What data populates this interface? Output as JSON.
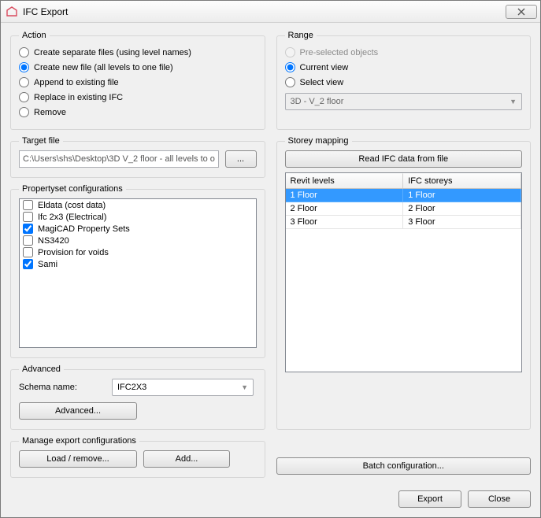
{
  "window": {
    "title": "IFC Export"
  },
  "action": {
    "legend": "Action",
    "options": [
      {
        "label": "Create separate files (using level names)",
        "checked": false
      },
      {
        "label": "Create new file (all levels to one file)",
        "checked": true
      },
      {
        "label": "Append to existing file",
        "checked": false
      },
      {
        "label": "Replace in existing IFC",
        "checked": false
      },
      {
        "label": "Remove",
        "checked": false
      }
    ]
  },
  "range": {
    "legend": "Range",
    "options": [
      {
        "label": "Pre-selected objects",
        "checked": false,
        "enabled": false
      },
      {
        "label": "Current view",
        "checked": true,
        "enabled": true
      },
      {
        "label": "Select view",
        "checked": false,
        "enabled": true
      }
    ],
    "view_select": "3D - V_2 floor"
  },
  "target": {
    "legend": "Target file",
    "path": "C:\\Users\\shs\\Desktop\\3D V_2 floor - all levels to o",
    "browse": "..."
  },
  "pset": {
    "legend": "Propertyset configurations",
    "items": [
      {
        "label": "Eldata (cost data)",
        "checked": false
      },
      {
        "label": "Ifc 2x3 (Electrical)",
        "checked": false
      },
      {
        "label": "MagiCAD Property Sets",
        "checked": true
      },
      {
        "label": "NS3420",
        "checked": false
      },
      {
        "label": "Provision for voids",
        "checked": false
      },
      {
        "label": "Sami",
        "checked": true
      }
    ]
  },
  "storey": {
    "legend": "Storey mapping",
    "read_button": "Read IFC data from file",
    "headers": {
      "left": "Revit levels",
      "right": "IFC storeys"
    },
    "rows": [
      {
        "left": "1 Floor",
        "right": "1 Floor",
        "selected": true
      },
      {
        "left": "2 Floor",
        "right": "2 Floor",
        "selected": false
      },
      {
        "left": "3 Floor",
        "right": "3 Floor",
        "selected": false
      }
    ]
  },
  "advanced": {
    "legend": "Advanced",
    "schema_label": "Schema name:",
    "schema_value": "IFC2X3",
    "advanced_button": "Advanced..."
  },
  "manage": {
    "legend": "Manage export configurations",
    "load_button": "Load / remove...",
    "add_button": "Add..."
  },
  "batch_button": "Batch configuration...",
  "footer": {
    "export": "Export",
    "close": "Close"
  }
}
